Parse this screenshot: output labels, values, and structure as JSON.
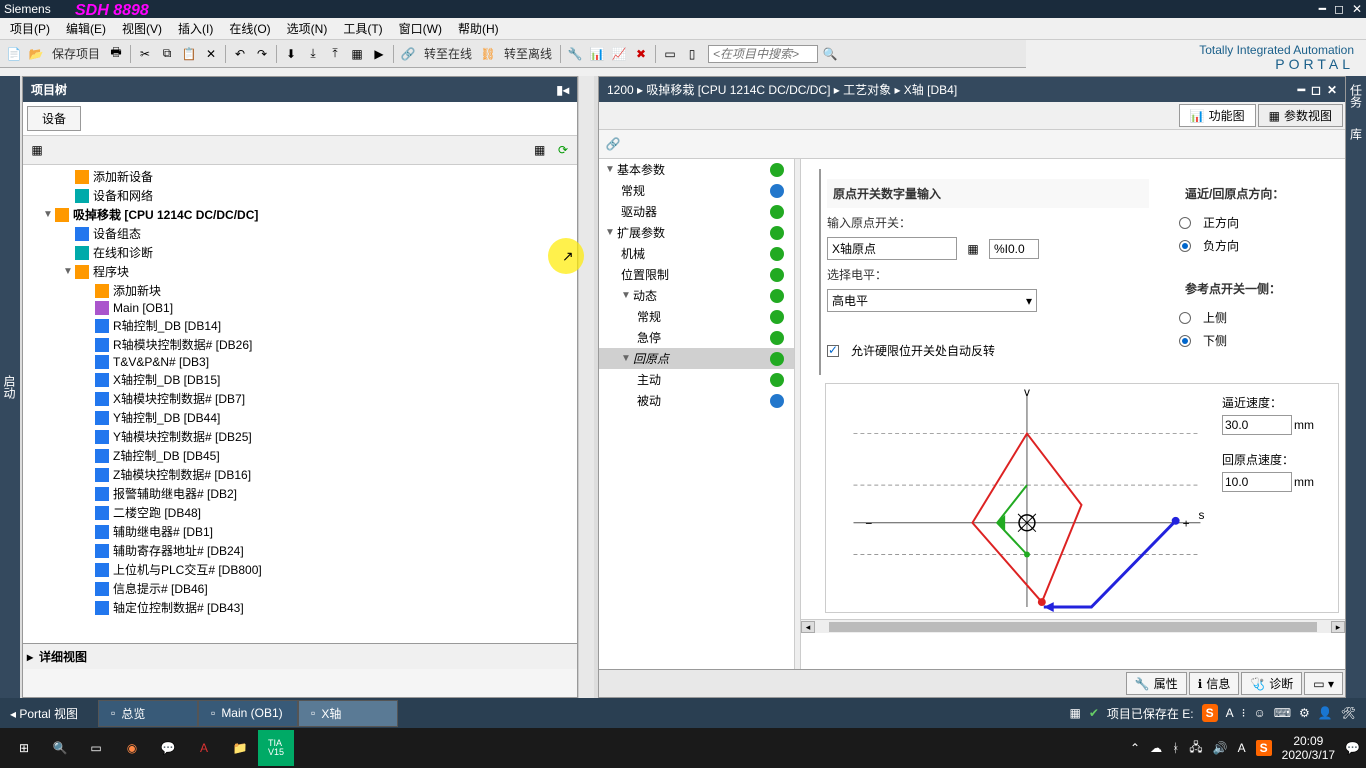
{
  "title": "Siemens",
  "watermark": "SDH 8898",
  "menu": [
    "项目(P)",
    "编辑(E)",
    "视图(V)",
    "插入(I)",
    "在线(O)",
    "选项(N)",
    "工具(T)",
    "窗口(W)",
    "帮助(H)"
  ],
  "brand": {
    "line1": "Totally Integrated Automation",
    "line2": "PORTAL"
  },
  "toolbar": {
    "save": "保存项目",
    "goonline": "转至在线",
    "gooffline": "转至离线",
    "search_ph": "<在项目中搜索>"
  },
  "projectTree": {
    "title": "项目树",
    "tab": "设备",
    "detail": "详细视图",
    "items": [
      {
        "icon": "ic-orange",
        "label": "添加新设备",
        "indent": 2
      },
      {
        "icon": "ic-teal",
        "label": "设备和网络",
        "indent": 2
      },
      {
        "icon": "ic-orange",
        "label": "吸掉移栽 [CPU 1214C DC/DC/DC]",
        "indent": 1,
        "exp": "▼",
        "bold": true
      },
      {
        "icon": "ic-blue",
        "label": "设备组态",
        "indent": 2
      },
      {
        "icon": "ic-teal",
        "label": "在线和诊断",
        "indent": 2
      },
      {
        "icon": "ic-orange",
        "label": "程序块",
        "indent": 2,
        "exp": "▼"
      },
      {
        "icon": "ic-orange",
        "label": "添加新块",
        "indent": 3
      },
      {
        "icon": "ic-purple",
        "label": "Main [OB1]",
        "indent": 3
      },
      {
        "icon": "ic-blue",
        "label": "R轴控制_DB [DB14]",
        "indent": 3
      },
      {
        "icon": "ic-blue",
        "label": "R轴模块控制数据# [DB26]",
        "indent": 3
      },
      {
        "icon": "ic-blue",
        "label": "T&V&P&N# [DB3]",
        "indent": 3
      },
      {
        "icon": "ic-blue",
        "label": "X轴控制_DB [DB15]",
        "indent": 3
      },
      {
        "icon": "ic-blue",
        "label": "X轴模块控制数据# [DB7]",
        "indent": 3
      },
      {
        "icon": "ic-blue",
        "label": "Y轴控制_DB [DB44]",
        "indent": 3
      },
      {
        "icon": "ic-blue",
        "label": "Y轴模块控制数据# [DB25]",
        "indent": 3
      },
      {
        "icon": "ic-blue",
        "label": "Z轴控制_DB [DB45]",
        "indent": 3
      },
      {
        "icon": "ic-blue",
        "label": "Z轴模块控制数据# [DB16]",
        "indent": 3
      },
      {
        "icon": "ic-blue",
        "label": "报警辅助继电器# [DB2]",
        "indent": 3
      },
      {
        "icon": "ic-blue",
        "label": "二楼空跑 [DB48]",
        "indent": 3
      },
      {
        "icon": "ic-blue",
        "label": "辅助继电器# [DB1]",
        "indent": 3
      },
      {
        "icon": "ic-blue",
        "label": "辅助寄存器地址# [DB24]",
        "indent": 3
      },
      {
        "icon": "ic-blue",
        "label": "上位机与PLC交互# [DB800]",
        "indent": 3
      },
      {
        "icon": "ic-blue",
        "label": "信息提示# [DB46]",
        "indent": 3
      },
      {
        "icon": "ic-blue",
        "label": "轴定位控制数据# [DB43]",
        "indent": 3
      }
    ]
  },
  "editor": {
    "breadcrumb": "1200  ▸  吸掉移栽 [CPU 1214C DC/DC/DC]  ▸  工艺对象  ▸  X轴 [DB4]",
    "viewtabs": {
      "func": "功能图",
      "param": "参数视图"
    },
    "params": [
      {
        "label": "基本参数",
        "indent": 0,
        "exp": "▼",
        "dot": "dot-green"
      },
      {
        "label": "常规",
        "indent": 1,
        "dot": "dot-blue"
      },
      {
        "label": "驱动器",
        "indent": 1,
        "dot": "dot-green"
      },
      {
        "label": "扩展参数",
        "indent": 0,
        "exp": "▼",
        "dot": "dot-green"
      },
      {
        "label": "机械",
        "indent": 1,
        "dot": "dot-green"
      },
      {
        "label": "位置限制",
        "indent": 1,
        "dot": "dot-green"
      },
      {
        "label": "动态",
        "indent": 1,
        "exp": "▼",
        "dot": "dot-green"
      },
      {
        "label": "常规",
        "indent": 2,
        "dot": "dot-green"
      },
      {
        "label": "急停",
        "indent": 2,
        "dot": "dot-green"
      },
      {
        "label": "回原点",
        "indent": 1,
        "exp": "▼",
        "dot": "dot-green",
        "sel": true
      },
      {
        "label": "主动",
        "indent": 2,
        "dot": "dot-green"
      },
      {
        "label": "被动",
        "indent": 2,
        "dot": "dot-blue"
      }
    ],
    "form": {
      "section_title": "原点开关数字量输入",
      "input_origin_label": "输入原点开关：",
      "input_origin_val": "X轴原点",
      "input_addr": "%I0.0",
      "level_label": "选择电平：",
      "level_val": "高电平",
      "checkbox_label": "允许硬限位开关处自动反转",
      "dir_title": "逼近/回原点方向：",
      "dir_pos": "正方向",
      "dir_neg": "负方向",
      "ref_title": "参考点开关一侧：",
      "ref_up": "上侧",
      "ref_down": "下侧",
      "approach_speed_label": "逼近速度：",
      "approach_speed": "30.0",
      "home_speed_label": "回原点速度：",
      "home_speed": "10.0",
      "unit": "mm"
    }
  },
  "bottomTabs": {
    "props": "属性",
    "info": "信息",
    "diag": "诊断"
  },
  "sidebarRight": [
    "任务",
    "库"
  ],
  "statusbar": {
    "portal": "Portal 视图",
    "tabs": [
      {
        "label": "总览"
      },
      {
        "label": "Main (OB1)"
      },
      {
        "label": "X轴",
        "active": true
      }
    ],
    "saved": "项目已保存在 E:"
  },
  "taskbar": {
    "time": "20:09",
    "date": "2020/3/17"
  }
}
